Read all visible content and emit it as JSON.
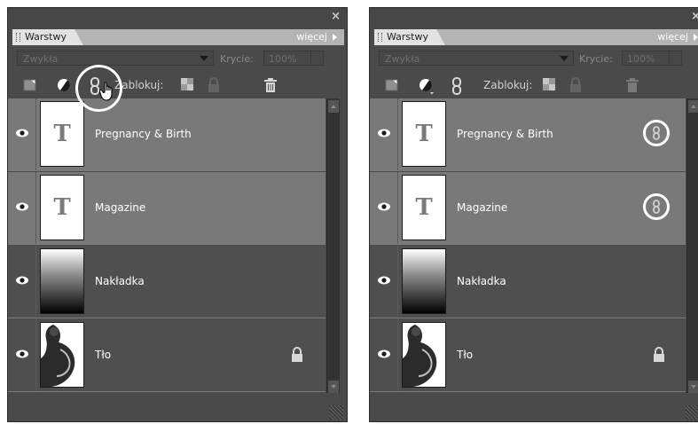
{
  "panels": [
    {
      "close_glyph": "×",
      "tab_label": "Warstwy",
      "more_label": "więcej",
      "blend_mode": "Zwykła",
      "opacity_label": "Krycie:",
      "opacity_value": "100%",
      "lock_label": "Zablokuj:",
      "layers": [
        {
          "name": "Pregnancy & Birth",
          "thumb": "text",
          "thumb_glyph": "T",
          "selected": true,
          "linked": false,
          "locked": false,
          "visible": true
        },
        {
          "name": "Magazine",
          "thumb": "text",
          "thumb_glyph": "T",
          "selected": true,
          "linked": false,
          "locked": false,
          "visible": true
        },
        {
          "name": "Nakładka",
          "thumb": "gradient",
          "selected": false,
          "linked": false,
          "locked": false,
          "visible": true
        },
        {
          "name": "Tło",
          "thumb": "photo",
          "selected": false,
          "linked": false,
          "locked": true,
          "visible": true
        }
      ],
      "highlight": "link-layers-button",
      "cursor": "hand-pointer-icon"
    },
    {
      "close_glyph": "×",
      "tab_label": "Warstwy",
      "more_label": "więcej",
      "blend_mode": "Zwykła",
      "opacity_label": "Krycie:",
      "opacity_value": "100%",
      "lock_label": "Zablokuj:",
      "layers": [
        {
          "name": "Pregnancy & Birth",
          "thumb": "text",
          "thumb_glyph": "T",
          "selected": true,
          "linked": true,
          "locked": false,
          "visible": true
        },
        {
          "name": "Magazine",
          "thumb": "text",
          "thumb_glyph": "T",
          "selected": true,
          "linked": true,
          "locked": false,
          "visible": true
        },
        {
          "name": "Nakładka",
          "thumb": "gradient",
          "selected": false,
          "linked": false,
          "locked": false,
          "visible": true
        },
        {
          "name": "Tło",
          "thumb": "photo",
          "selected": false,
          "linked": false,
          "locked": true,
          "visible": true
        }
      ]
    }
  ],
  "colors": {
    "panel_bg": "#4a4a4a",
    "selected_row": "#797979",
    "unselected_row": "#4f4f4f",
    "tabstrip": "#b4b4b4",
    "highlight_ring": "#ffffff"
  }
}
